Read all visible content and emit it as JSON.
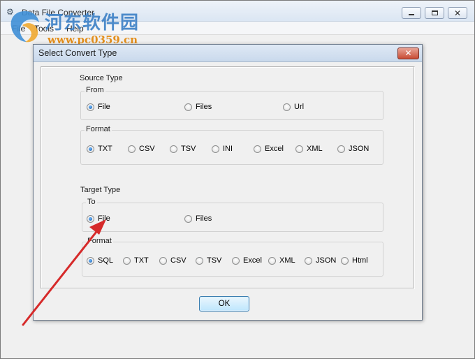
{
  "app": {
    "title": "Data File Converter",
    "menu": [
      "File",
      "Tools",
      "Help"
    ]
  },
  "watermark": {
    "line1": "河东软件园",
    "line2": "www.pc0359.cn"
  },
  "dialog": {
    "title": "Select Convert Type",
    "close_glyph": "✕",
    "source": {
      "label": "Source Type",
      "from_label": "From",
      "from_options": [
        "File",
        "Files",
        "Url"
      ],
      "from_selected": "File",
      "format_label": "Format",
      "format_options": [
        "TXT",
        "CSV",
        "TSV",
        "INI",
        "Excel",
        "XML",
        "JSON"
      ],
      "format_selected": "TXT"
    },
    "target": {
      "label": "Target Type",
      "to_label": "To",
      "to_options": [
        "File",
        "Files"
      ],
      "to_selected": "File",
      "format_label": "Format",
      "format_options": [
        "SQL",
        "TXT",
        "CSV",
        "TSV",
        "Excel",
        "XML",
        "JSON",
        "Html"
      ],
      "format_selected": "SQL"
    },
    "ok_label": "OK"
  },
  "colors": {
    "annotation_arrow": "#d62a2a",
    "title_gradient": "#dbe6f3",
    "ok_border": "#3c7fb1"
  }
}
